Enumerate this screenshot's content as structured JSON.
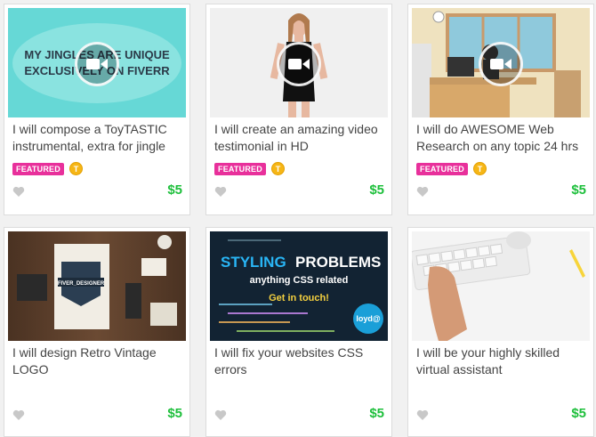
{
  "gigs": [
    {
      "title": "I will compose a ToyTASTIC instrumental, extra for jingle",
      "featured": "FEATURED",
      "level": "T",
      "price": "$5",
      "thumb_text_1": "MY JINGLES ARE UNIQUE",
      "thumb_text_2": "EXCLUSIVELY ON FIVERR"
    },
    {
      "title": "I will create an amazing video testimonial in HD",
      "featured": "FEATURED",
      "level": "T",
      "price": "$5"
    },
    {
      "title": "I will do AWESOME Web Research on any topic 24 hrs",
      "featured": "FEATURED",
      "level": "T",
      "price": "$5"
    },
    {
      "title": "I will design Retro Vintage LOGO",
      "price": "$5",
      "thumb_badge": "FIVER_DESIGNER"
    },
    {
      "title": "I will fix your websites CSS errors",
      "price": "$5",
      "thumb_line_1": "STYLING",
      "thumb_line_1b": "PROBLEMS",
      "thumb_line_2": "anything CSS related",
      "thumb_line_3": "Get in touch!",
      "thumb_logo": "loyd@"
    },
    {
      "title": "I will be your highly skilled virtual assistant",
      "price": "$5"
    }
  ],
  "icons": {
    "play": "video-play-icon",
    "heart": "heart-icon"
  },
  "colors": {
    "featured": "#e8309b",
    "price": "#1dbf3b",
    "level": "#f6b616"
  }
}
